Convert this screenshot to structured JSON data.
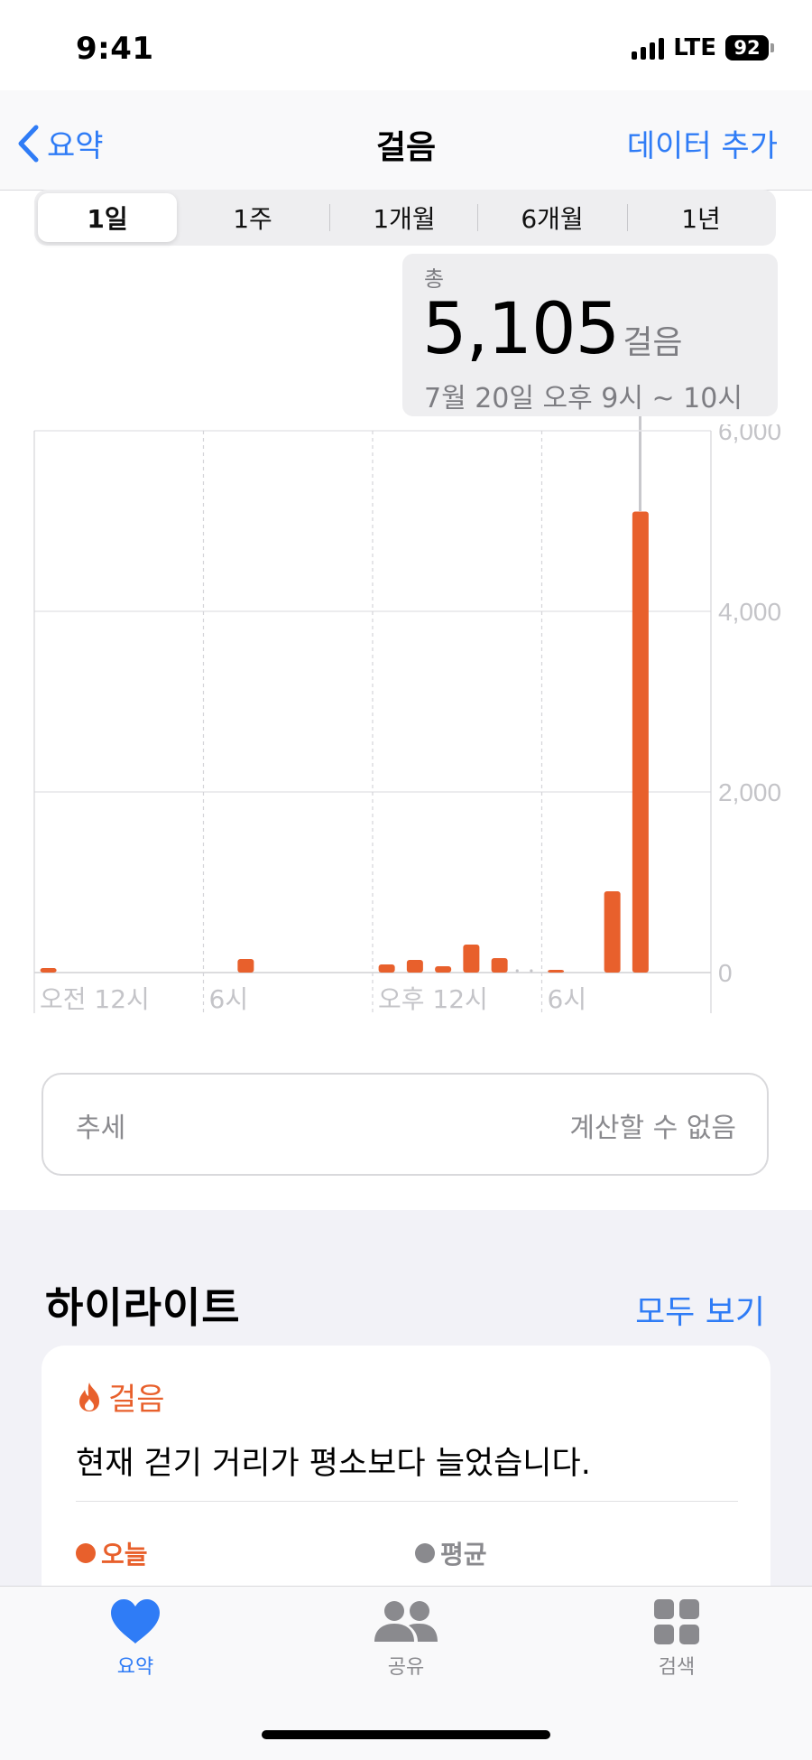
{
  "status": {
    "time": "9:41",
    "network": "LTE",
    "battery": "92"
  },
  "nav": {
    "back_label": "요약",
    "title": "걸음",
    "action_label": "데이터 추가"
  },
  "segments": [
    "1일",
    "1주",
    "1개월",
    "6개월",
    "1년"
  ],
  "selected_segment": "1일",
  "tooltip": {
    "caption": "총",
    "value": "5,105",
    "unit": "걸음",
    "range": "7월 20일 오후 9시 ~ 10시"
  },
  "chart_data": {
    "type": "bar",
    "xlabels": [
      "오전 12시",
      "6시",
      "오후 12시",
      "6시"
    ],
    "ylim": [
      0,
      6000
    ],
    "yticks": [
      "6,000",
      "4,000",
      "2,000",
      "0"
    ],
    "hours": [
      0,
      7,
      12,
      13,
      14,
      15,
      16,
      18,
      20,
      21
    ],
    "values": [
      50,
      150,
      90,
      140,
      70,
      310,
      160,
      30,
      900,
      5105
    ],
    "highlight_hour": 21,
    "bar_color": "#e8602c"
  },
  "trend": {
    "label": "추세",
    "value": "계산할 수 없음"
  },
  "highlights": {
    "title": "하이라이트",
    "see_all": "모두 보기",
    "card": {
      "tag": "걸음",
      "text": "현재 걷기 거리가 평소보다 늘었습니다.",
      "legend_today": "오늘",
      "legend_avg": "평균"
    }
  },
  "tabs": [
    {
      "label": "요약",
      "icon": "heart-icon",
      "active": true
    },
    {
      "label": "공유",
      "icon": "people-icon",
      "active": false
    },
    {
      "label": "검색",
      "icon": "grid-icon",
      "active": false
    }
  ],
  "colors": {
    "accent": "#2f7cf6",
    "steps": "#e8602c",
    "gray": "#8a8a8e"
  }
}
